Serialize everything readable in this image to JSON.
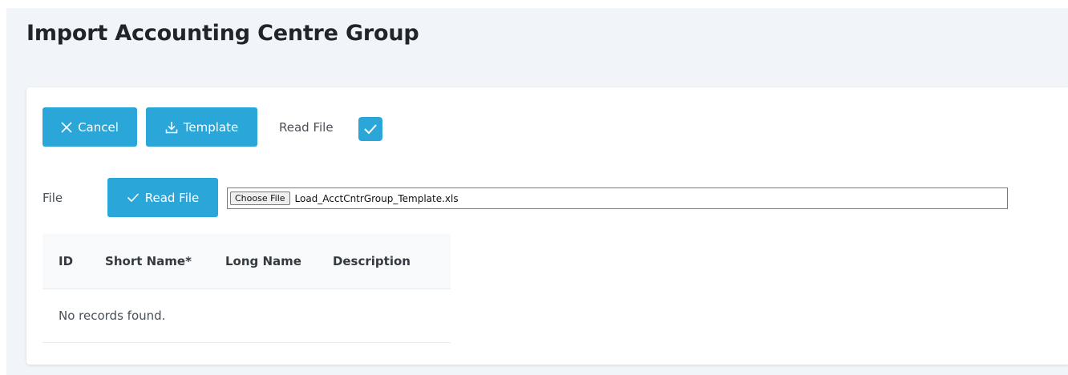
{
  "page": {
    "title": "Import Accounting Centre Group"
  },
  "toolbar": {
    "cancel_label": "Cancel",
    "cancel_icon": "close-icon",
    "template_label": "Template",
    "template_icon": "download-icon",
    "read_file_label": "Read File",
    "read_file_checked": true
  },
  "file_section": {
    "label": "File",
    "read_button_label": "Read File",
    "read_button_icon": "check-icon",
    "choose_button_label": "Choose File",
    "chosen_file_name": "Load_AcctCntrGroup_Template.xls"
  },
  "table": {
    "columns": [
      "ID",
      "Short Name*",
      "Long Name",
      "Description"
    ],
    "empty_message": "No records found."
  },
  "colors": {
    "accent": "#2aa6d9",
    "page_background": "#f1f4f8",
    "card_background": "#ffffff",
    "header_background": "#f8f9fa"
  }
}
